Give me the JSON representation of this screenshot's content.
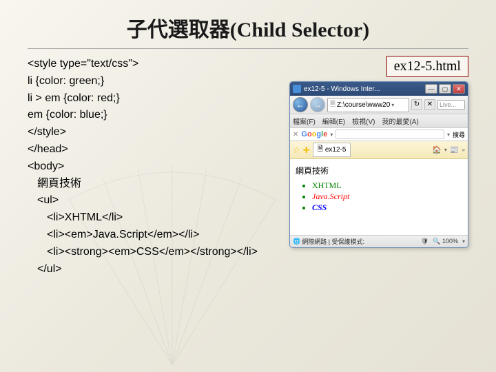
{
  "title": "子代選取器(Child Selector)",
  "filename": "ex12-5.html",
  "code": {
    "l1": "<style type=\"text/css\">",
    "l2": "li {color: green;}",
    "l3": "li > em {color: red;}",
    "l4": "em {color: blue;}",
    "l5": "</style>",
    "l6": "</head>",
    "l7": "<body>",
    "l8": "網頁技術",
    "l9": "<ul>",
    "l10": "<li>XHTML</li>",
    "l11": "<li><em>Java.Script</em></li>",
    "l12": "<li><strong><em>CSS</em></strong></li>",
    "l13": "</ul>"
  },
  "browser": {
    "title": "ex12-5 - Windows Inter...",
    "address": "Z:\\course\\www20",
    "search_placeholder": "Live...",
    "menu": {
      "file": "檔案(F)",
      "edit": "編輯(E)",
      "view": "檢視(V)",
      "fav": "我的最愛(A)"
    },
    "google_search_btn": "搜尋",
    "tab_label": "ex12-5",
    "page_heading": "網頁技術",
    "list": {
      "item1": "XHTML",
      "item2": "Java.Script",
      "item3": "CSS"
    },
    "status": {
      "zone": "網際網路 | 受保護模式:",
      "zoom": "100%"
    }
  }
}
